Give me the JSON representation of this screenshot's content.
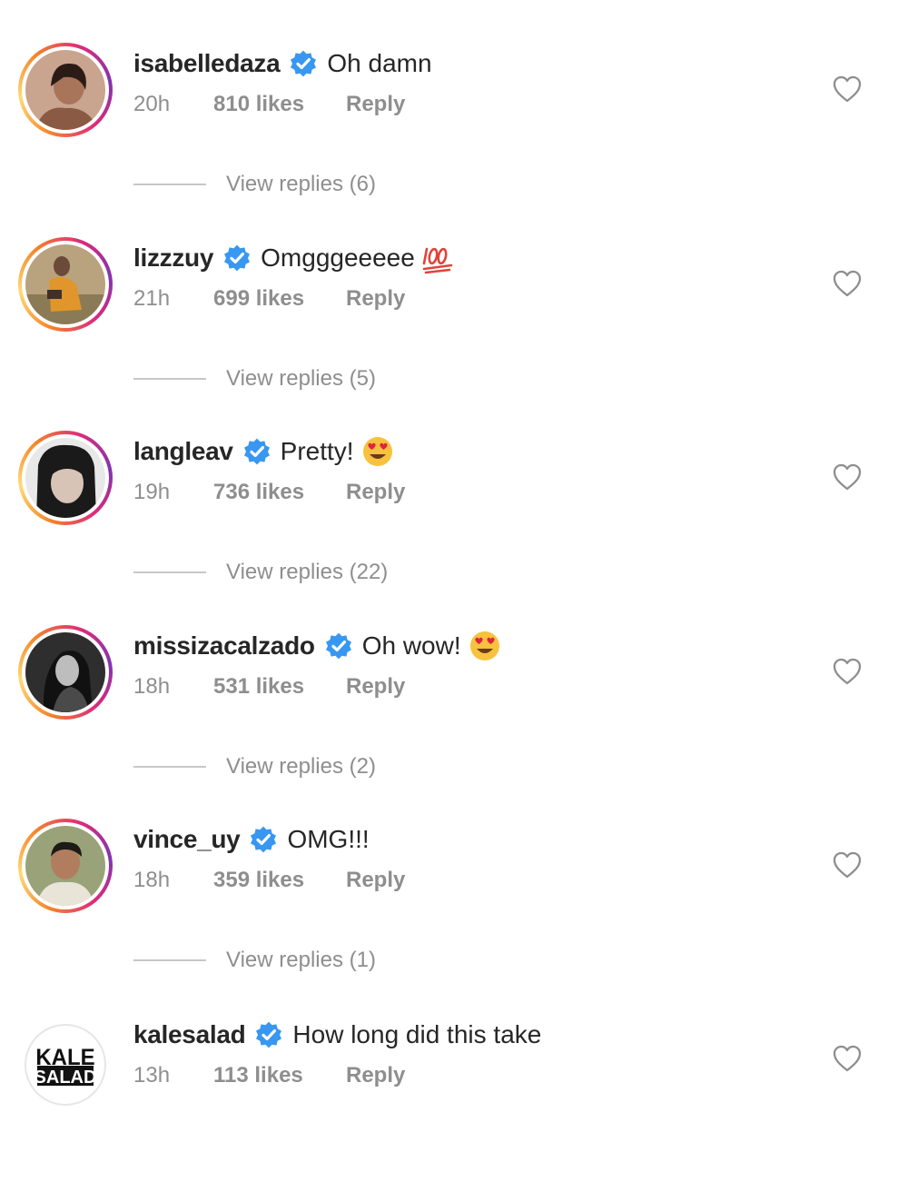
{
  "comments": [
    {
      "username": "isabelledaza",
      "text": "Oh damn",
      "emoji": "",
      "time": "20h",
      "likes": "810 likes",
      "reply_label": "Reply",
      "view_replies": "View replies (6)"
    },
    {
      "username": "lizzzuy",
      "text": "Omgggeeeee",
      "emoji": "hundred-points-icon",
      "time": "21h",
      "likes": "699 likes",
      "reply_label": "Reply",
      "view_replies": "View replies (5)"
    },
    {
      "username": "langleav",
      "text": "Pretty!",
      "emoji": "heart-eyes-icon",
      "time": "19h",
      "likes": "736 likes",
      "reply_label": "Reply",
      "view_replies": "View replies (22)"
    },
    {
      "username": "missizacalzado",
      "text": "Oh wow!",
      "emoji": "heart-eyes-icon",
      "time": "18h",
      "likes": "531 likes",
      "reply_label": "Reply",
      "view_replies": "View replies (2)"
    },
    {
      "username": "vince_uy",
      "text": "OMG!!!",
      "emoji": "",
      "time": "18h",
      "likes": "359 likes",
      "reply_label": "Reply",
      "view_replies": "View replies (1)"
    },
    {
      "username": "kalesalad",
      "text": "How long did this take",
      "emoji": "",
      "time": "13h",
      "likes": "113 likes",
      "reply_label": "Reply",
      "view_replies": ""
    }
  ],
  "kalesalad_logo": [
    "KALE",
    "SALAD"
  ],
  "colors": {
    "verified": "#3897f0",
    "muted": "#8e8e8e",
    "text": "#262626",
    "ring_start": "#f58529",
    "ring_end": "#dd2a7b"
  }
}
